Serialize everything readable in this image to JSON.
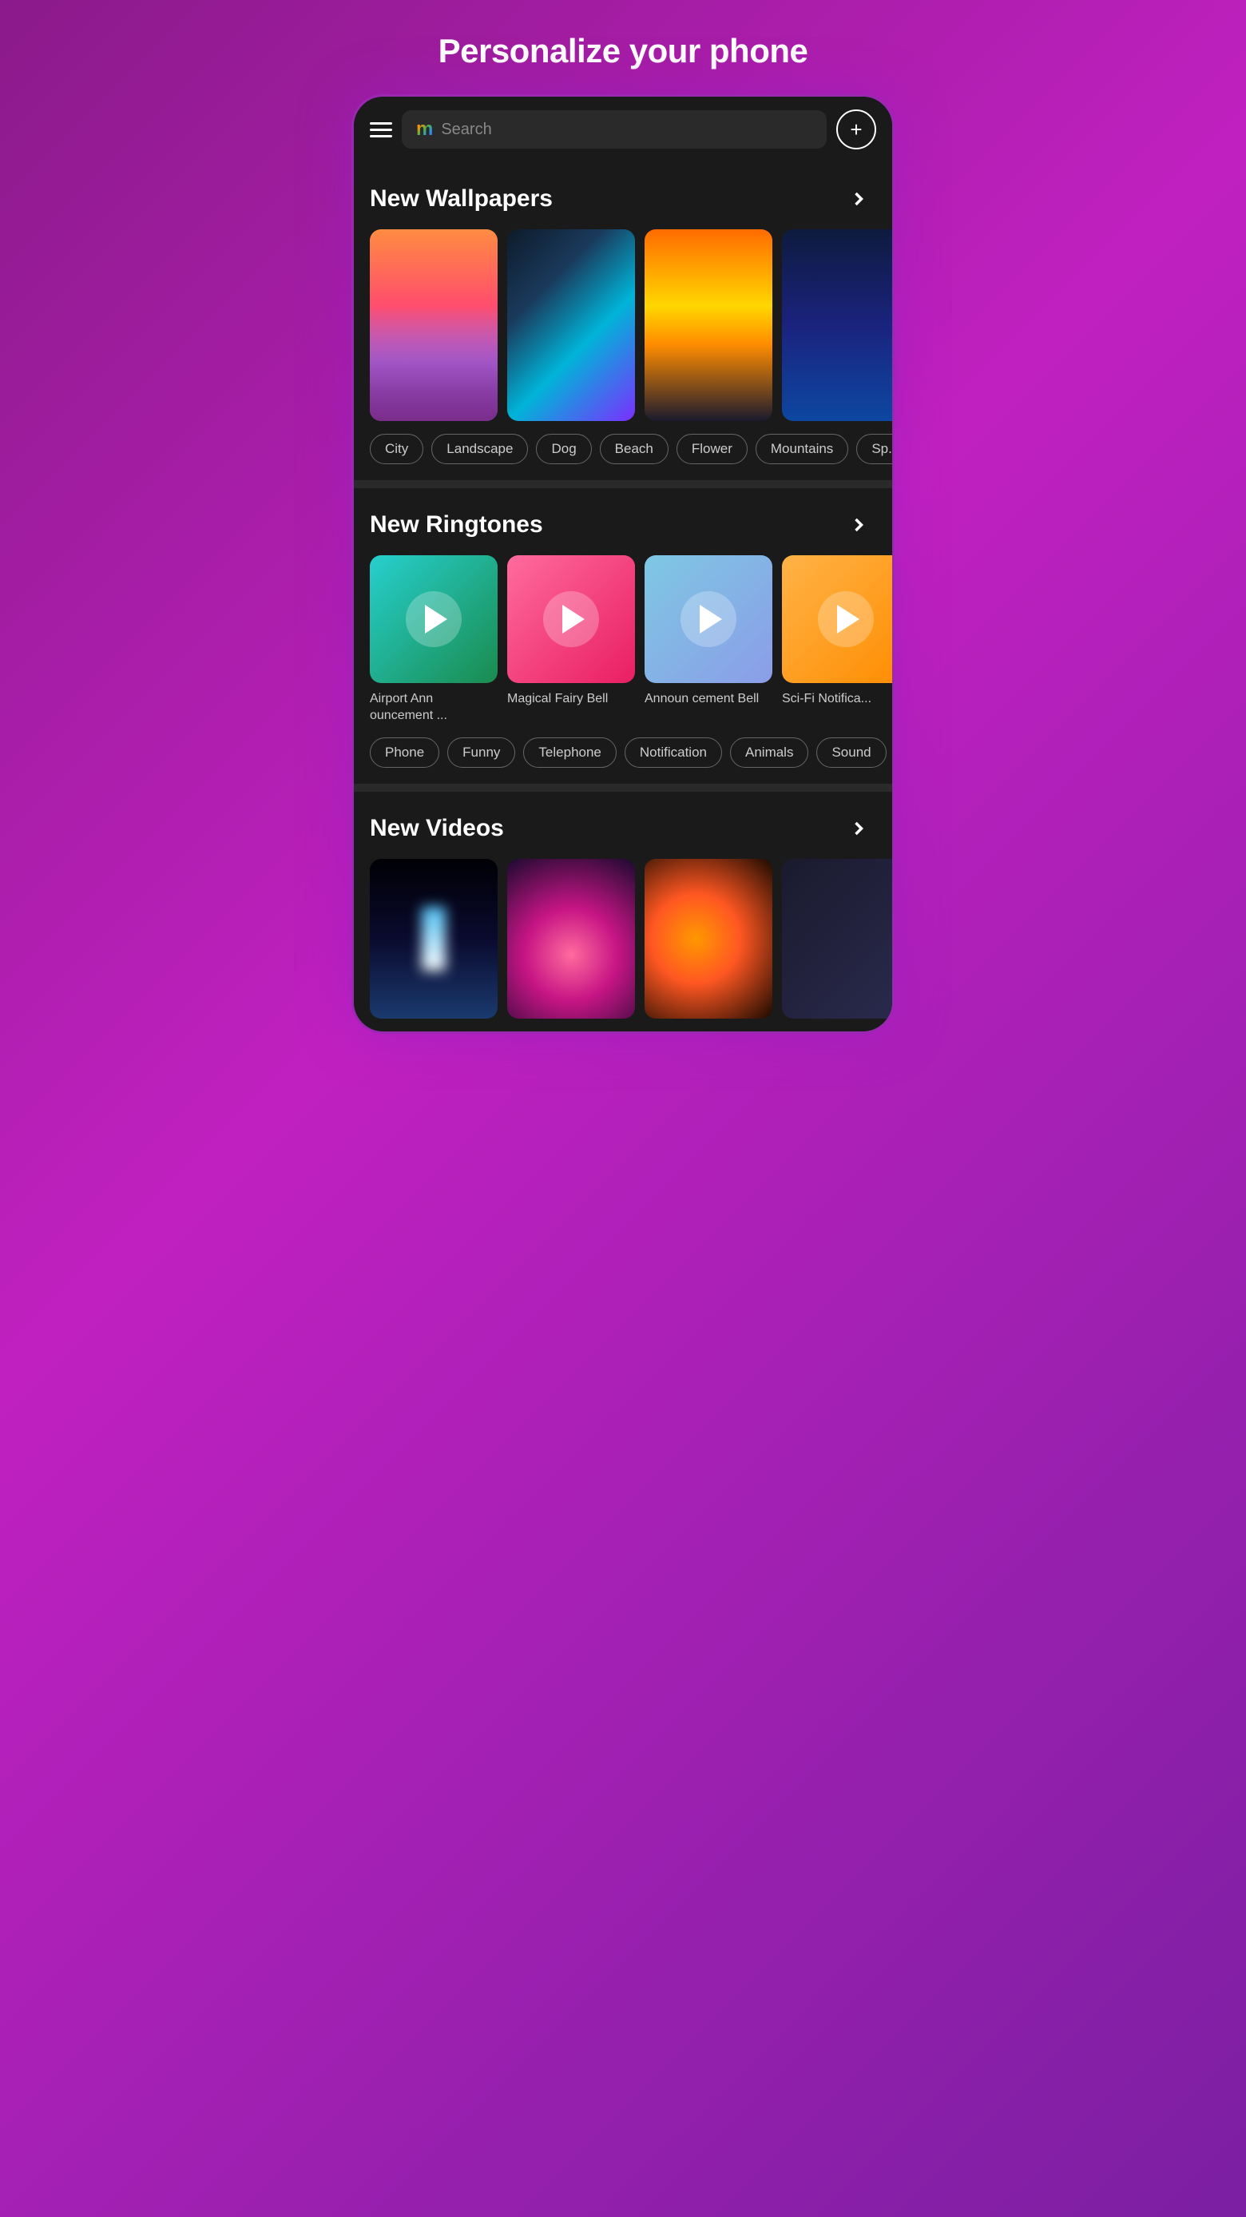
{
  "page": {
    "title": "Personalize your phone"
  },
  "header": {
    "search_placeholder": "Search",
    "logo": "m",
    "add_label": "+"
  },
  "wallpapers": {
    "section_title": "New Wallpapers",
    "tags": [
      "City",
      "Landscape",
      "Dog",
      "Beach",
      "Flower",
      "Mountains",
      "Sp..."
    ]
  },
  "ringtones": {
    "section_title": "New Ringtones",
    "items": [
      {
        "name": "Airport Ann ouncement ..."
      },
      {
        "name": "Magical Fairy Bell"
      },
      {
        "name": "Announ cement Bell"
      },
      {
        "name": "Sci-Fi Notifica..."
      }
    ],
    "tags": [
      "Phone",
      "Funny",
      "Telephone",
      "Notification",
      "Animals",
      "Sound"
    ]
  },
  "videos": {
    "section_title": "New Videos"
  },
  "icons": {
    "menu": "☰",
    "chevron_right": ">",
    "play": "▶"
  }
}
